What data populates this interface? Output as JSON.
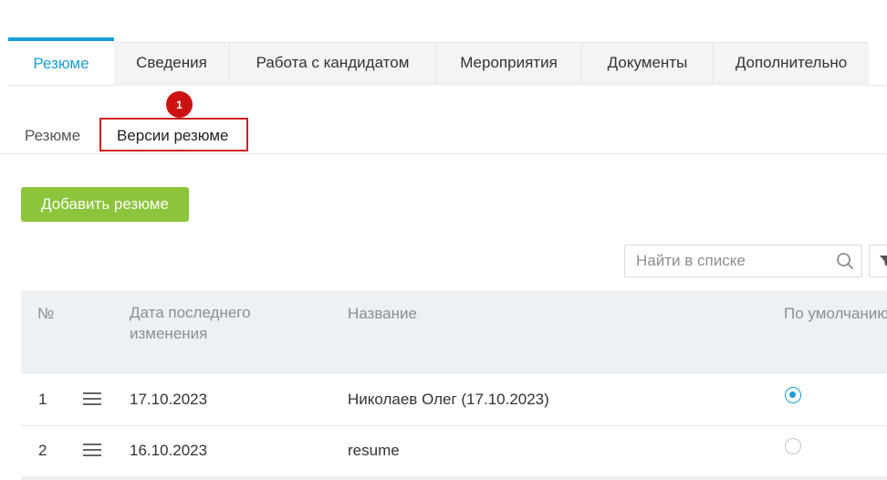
{
  "tabs": [
    {
      "label": "Резюме",
      "active": true
    },
    {
      "label": "Сведения",
      "active": false
    },
    {
      "label": "Работа с кандидатом",
      "active": false
    },
    {
      "label": "Мероприятия",
      "active": false
    },
    {
      "label": "Документы",
      "active": false
    },
    {
      "label": "Дополнительно",
      "active": false
    }
  ],
  "subtabs": {
    "resume": "Резюме",
    "versions": "Версии резюме"
  },
  "annotation": {
    "badge": "1"
  },
  "add_button": "Добавить резюме",
  "search": {
    "placeholder": "Найти в списке"
  },
  "table": {
    "headers": {
      "num": "№",
      "date": "Дата последнего изменения",
      "name": "Название",
      "default": "По умолчанию"
    },
    "rows": [
      {
        "num": "1",
        "date": "17.10.2023",
        "name": "Николаев Олег (17.10.2023)",
        "default": true
      },
      {
        "num": "2",
        "date": "16.10.2023",
        "name": "resume",
        "default": false
      }
    ]
  },
  "colors": {
    "accent": "#1a9ed9",
    "add_button": "#8cc43c",
    "annotation": "#cc1f1f"
  }
}
